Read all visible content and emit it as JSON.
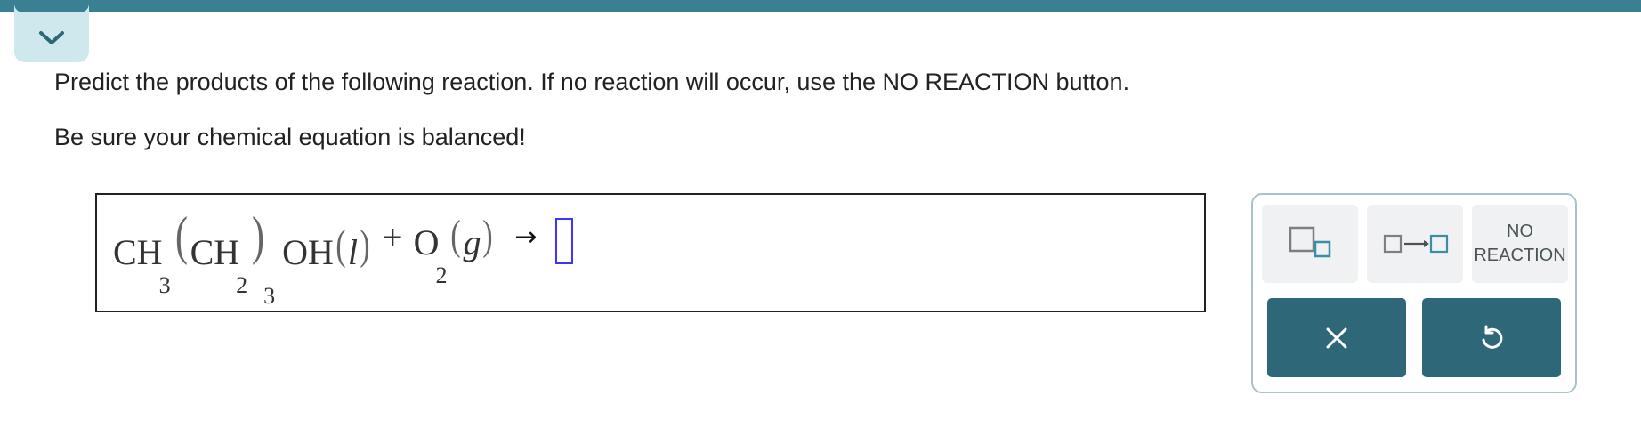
{
  "header": {
    "collapse_icon": "chevron-down-icon"
  },
  "prompt": {
    "line1": "Predict the products of the following reaction. If no reaction will occur, use the NO REACTION button.",
    "line2": "Be sure your chemical equation is balanced!"
  },
  "equation": {
    "reactant1": {
      "main1": "CH",
      "sub1": "3",
      "inner_main": "CH",
      "inner_sub": "2",
      "group_sub": "3",
      "main2": "OH",
      "state": "l"
    },
    "plus": "+",
    "reactant2": {
      "main": "O",
      "sub": "2",
      "state": "g"
    },
    "arrow": "→"
  },
  "toolbox": {
    "subscript_icon": "subscript-box-icon",
    "arrow_icon": "reaction-arrow-box-icon",
    "no_reaction_line1": "NO",
    "no_reaction_line2": "REACTION",
    "clear_icon": "close-icon",
    "undo_icon": "undo-icon"
  },
  "colors": {
    "accent": "#3a7f92",
    "tab_bg": "#cfe8ee",
    "button_dark": "#2e6878",
    "tool_bg": "#f0f1f2",
    "slot_border": "#3b35ff",
    "toolbox_border": "#a9c2cb"
  }
}
